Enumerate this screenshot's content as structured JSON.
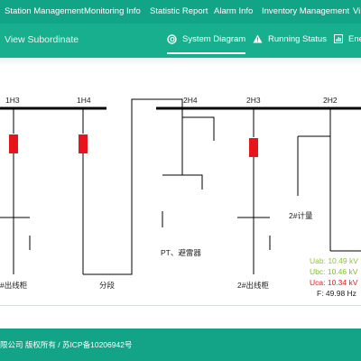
{
  "topnav": {
    "items": [
      "Station Management",
      "Monitoring Info",
      "Statistic Report",
      "Alarm Info",
      "Inventory Management",
      "Vi"
    ]
  },
  "subnav": {
    "title": "View Subordinate",
    "tabs": [
      "System Diagram",
      "Running Status",
      "Ene"
    ],
    "active_tab": "System Diagram"
  },
  "diagram": {
    "bus_labels": [
      "1H3",
      "1H4",
      "2H4",
      "2H3",
      "2H2"
    ],
    "feeder_labels": [
      "#出线柜",
      "分段",
      "PT、避雷器",
      "2#出线柜",
      "2#计量"
    ],
    "breaker_color": "#e8141c"
  },
  "measurements": [
    {
      "label": "Uab: 10.49 kV",
      "color": "#8dc63f"
    },
    {
      "label": "Ubc: 10.46 kV",
      "color": "#7cc128"
    },
    {
      "label": "Uca: 10.34 kV",
      "color": "#e02020"
    },
    {
      "label": "F: 49.98 Hz",
      "color": "#222222"
    }
  ],
  "footer": {
    "text": "限公司 版权所有 / 苏ICP备10206942号"
  },
  "colors": {
    "header": "#12a487",
    "subheader": "#18af8f",
    "footer": "#13a386"
  }
}
